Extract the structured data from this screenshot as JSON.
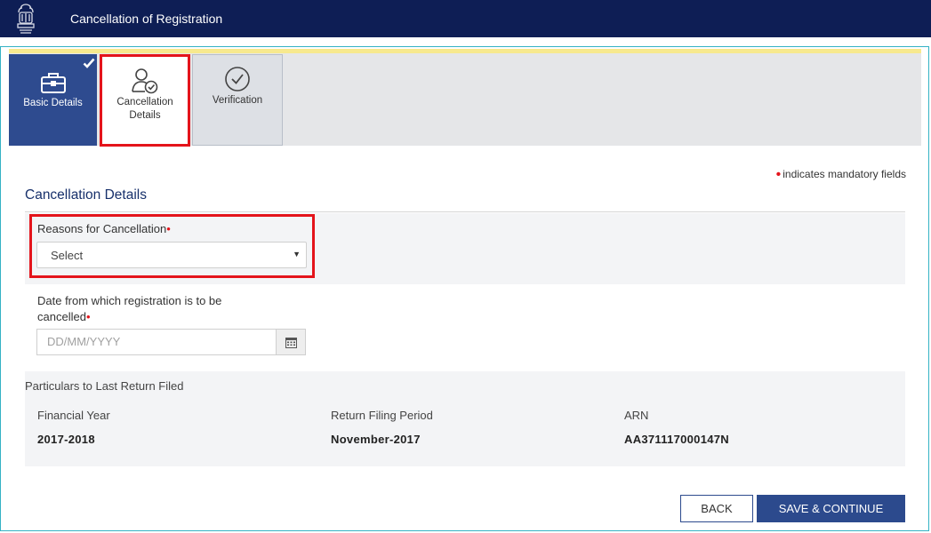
{
  "header": {
    "title": "Cancellation of Registration",
    "logo_icon": "national-emblem-icon"
  },
  "colors": {
    "header_bg": "#0e1e55",
    "accent": "#2c4a8d",
    "highlight_box": "#e4141b",
    "frame_border": "#35b2c4"
  },
  "tabs": [
    {
      "label": "Basic Details",
      "icon": "briefcase-icon",
      "completed": true
    },
    {
      "label": "Cancellation Details",
      "icon": "person-check-icon",
      "active": true
    },
    {
      "label": "Verification",
      "icon": "checkmark-circle-icon"
    }
  ],
  "form": {
    "mandatory_note": "indicates mandatory fields",
    "section_title": "Cancellation Details",
    "reason": {
      "label": "Reasons for Cancellation",
      "required_mark": "•",
      "value": "Select"
    },
    "date": {
      "label_line1": "Date from which registration is to be",
      "label_line2": "cancelled",
      "required_mark": "•",
      "placeholder": "DD/MM/YYYY",
      "icon": "calendar-icon"
    }
  },
  "particulars": {
    "title": "Particulars to Last Return Filed",
    "columns": [
      {
        "label": "Financial Year",
        "value": "2017-2018"
      },
      {
        "label": "Return Filing Period",
        "value": "November-2017"
      },
      {
        "label": "ARN",
        "value": "AA371117000147N"
      }
    ]
  },
  "buttons": {
    "back": "BACK",
    "save": "SAVE & CONTINUE"
  }
}
